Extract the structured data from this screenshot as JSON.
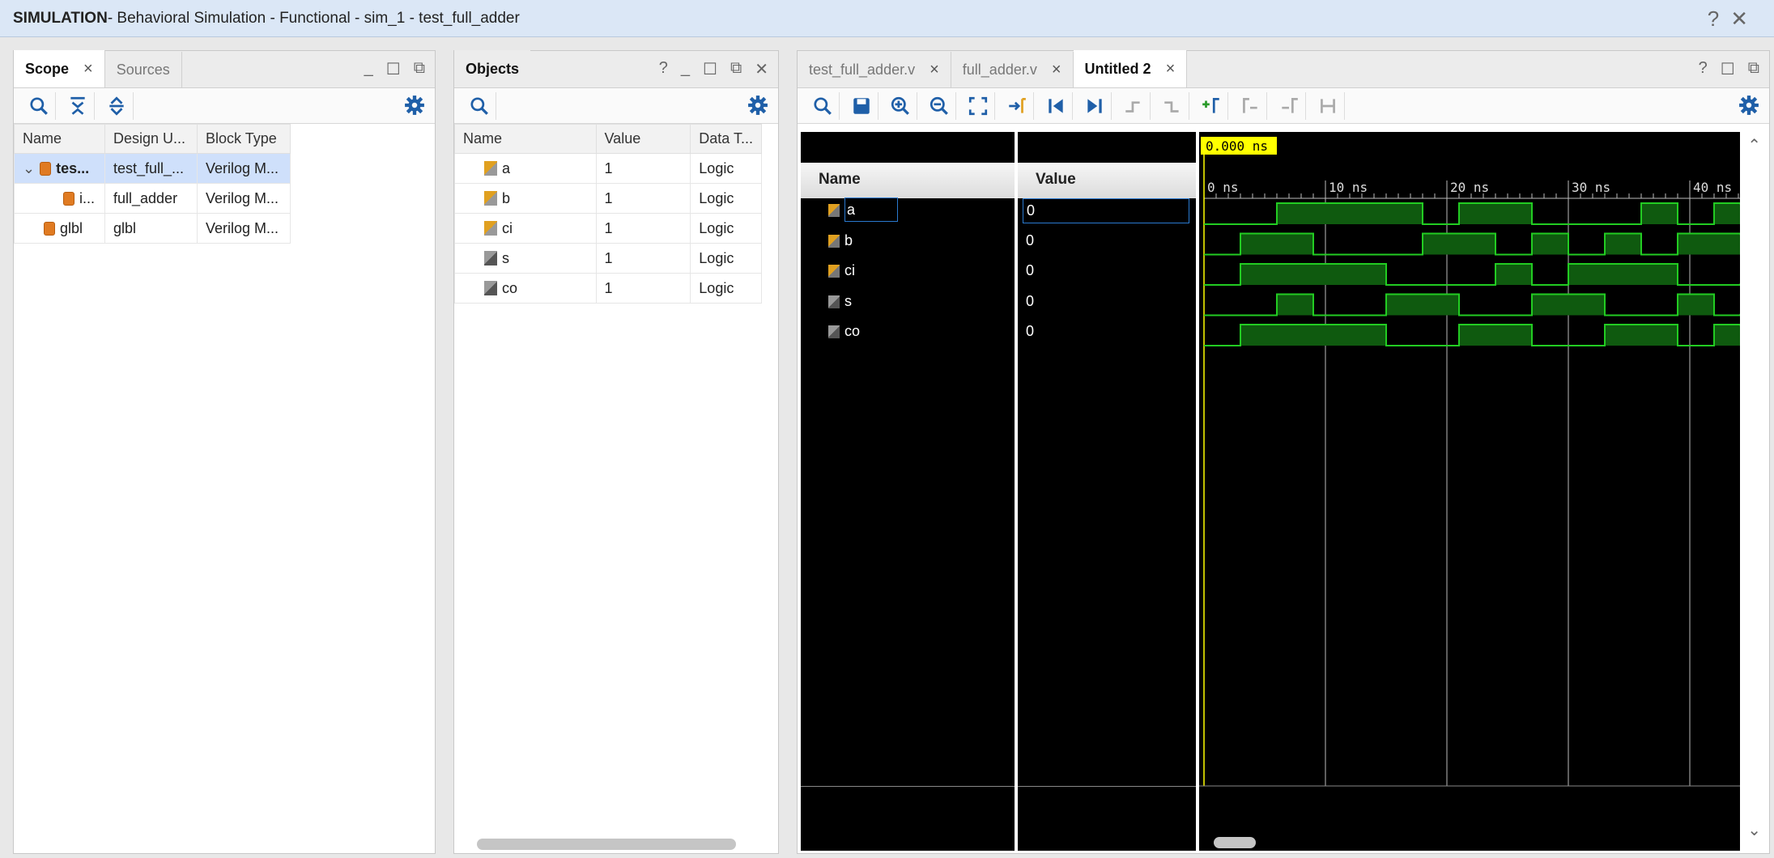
{
  "title": {
    "prefix": "SIMULATION",
    "rest": " - Behavioral Simulation - Functional - sim_1 - test_full_adder",
    "help": "?",
    "close": "✕"
  },
  "scope": {
    "tabs": [
      {
        "label": "Scope"
      },
      {
        "label": "Sources"
      }
    ],
    "columns": [
      "Name",
      "Design U...",
      "Block Type"
    ],
    "rows": [
      {
        "name": "tes...",
        "design": "test_full_...",
        "type": "Verilog M..."
      },
      {
        "name": "i...",
        "design": "full_adder",
        "type": "Verilog M..."
      },
      {
        "name": "glbl",
        "design": "glbl",
        "type": "Verilog M..."
      }
    ]
  },
  "objects": {
    "title": "Objects",
    "columns": [
      "Name",
      "Value",
      "Data T..."
    ],
    "rows": [
      {
        "name": "a",
        "value": "1",
        "type": "Logic"
      },
      {
        "name": "b",
        "value": "1",
        "type": "Logic"
      },
      {
        "name": "ci",
        "value": "1",
        "type": "Logic"
      },
      {
        "name": "s",
        "value": "1",
        "type": "Logic"
      },
      {
        "name": "co",
        "value": "1",
        "type": "Logic"
      }
    ]
  },
  "wave": {
    "tabs": [
      {
        "label": "test_full_adder.v"
      },
      {
        "label": "full_adder.v"
      },
      {
        "label": "Untitled 2"
      }
    ],
    "name_header": "Name",
    "value_header": "Value",
    "cursor": "0.000 ns",
    "ticks": [
      "0 ns",
      "10 ns",
      "20 ns",
      "30 ns",
      "40 ns"
    ],
    "signals": [
      {
        "name": "a",
        "value": "0"
      },
      {
        "name": "b",
        "value": "0"
      },
      {
        "name": "ci",
        "value": "0"
      },
      {
        "name": "s",
        "value": "0"
      },
      {
        "name": "co",
        "value": "0"
      }
    ],
    "colors": {
      "wave": "#22cc22",
      "fill": "#0f5a0f",
      "cursor": "#ffff00"
    }
  }
}
